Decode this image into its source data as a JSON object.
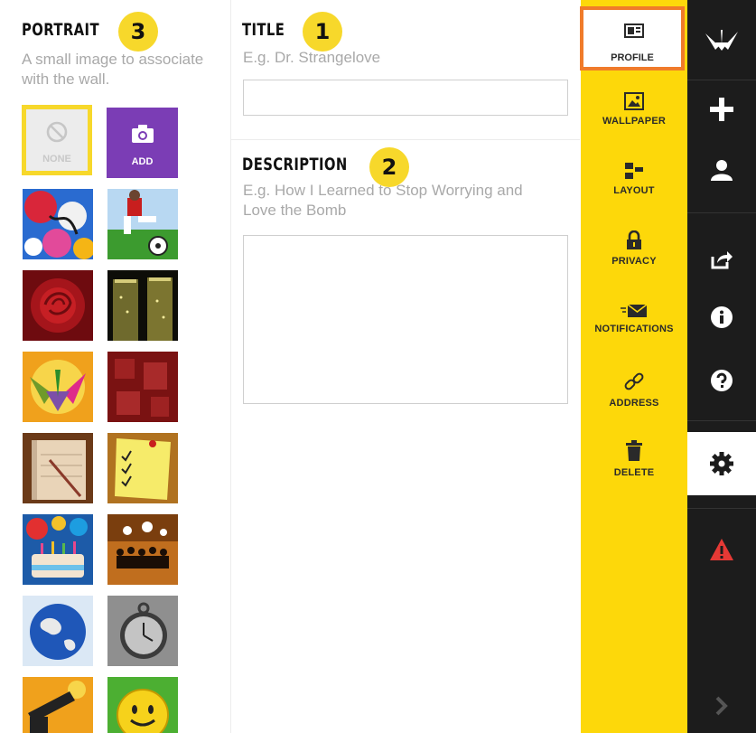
{
  "portrait": {
    "heading": "PORTRAIT",
    "badge": "3",
    "hint": "A small image to associate with the wall.",
    "none_label": "NONE",
    "add_label": "ADD"
  },
  "title": {
    "heading": "TITLE",
    "badge": "1",
    "placeholder": "E.g. Dr. Strangelove",
    "value": ""
  },
  "description": {
    "heading": "DESCRIPTION",
    "badge": "2",
    "placeholder": "E.g. How I Learned to Stop Worrying and Love the Bomb",
    "value": ""
  },
  "settings": {
    "items": [
      {
        "label": "PROFILE",
        "icon": "profile-icon",
        "active": true
      },
      {
        "label": "WALLPAPER",
        "icon": "image-icon"
      },
      {
        "label": "LAYOUT",
        "icon": "layout-icon"
      },
      {
        "label": "PRIVACY",
        "icon": "lock-icon"
      },
      {
        "label": "NOTIFICATIONS",
        "icon": "mail-icon"
      },
      {
        "label": "ADDRESS",
        "icon": "link-icon"
      },
      {
        "label": "DELETE",
        "icon": "trash-icon"
      }
    ],
    "active_border_color": "#f07b2a",
    "background_color": "#fdd80a"
  },
  "rail": {
    "items": [
      "logo-icon",
      "plus-icon",
      "user-icon",
      "share-icon",
      "info-icon",
      "help-icon",
      "gear-icon",
      "warning-icon",
      "chevron-right-icon"
    ],
    "background_color": "#1c1c1c",
    "active_item": "gear-icon"
  },
  "colors": {
    "badge": "#f7d82b",
    "add_tile": "#7b3db5",
    "warning": "#e53935"
  }
}
